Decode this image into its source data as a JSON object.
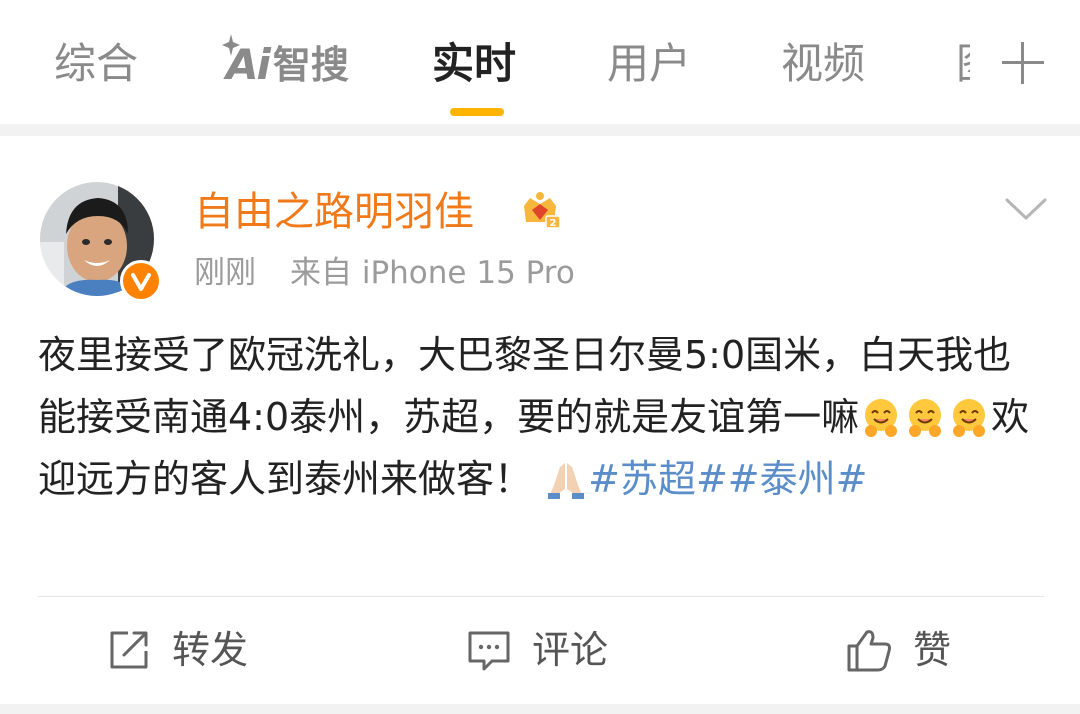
{
  "tabs": [
    {
      "label": "综合"
    },
    {
      "label": "AI智搜",
      "mark": "Ai",
      "text": "智搜"
    },
    {
      "label": "实时"
    },
    {
      "label": "用户"
    },
    {
      "label": "视频"
    },
    {
      "label": "图"
    }
  ],
  "accent": "#ffb400",
  "post": {
    "author": "自由之路明羽佳",
    "time": "刚刚",
    "source": "来自 iPhone 15 Pro",
    "text_part1": "夜里接受了欧冠洗礼，大巴黎圣日尔曼5:0国米，白天我也能接受南通4:0泰州，苏超，要的就是友谊第一嘛",
    "text_part2": "欢迎远方的客人到泰州来做客！",
    "topic1": "#苏超#",
    "topic2": "#泰州#",
    "emojis": [
      "hug-emoji",
      "hug-emoji",
      "hug-emoji",
      "pray-emoji"
    ]
  },
  "actions": {
    "repost": "转发",
    "comment": "评论",
    "like": "赞"
  }
}
